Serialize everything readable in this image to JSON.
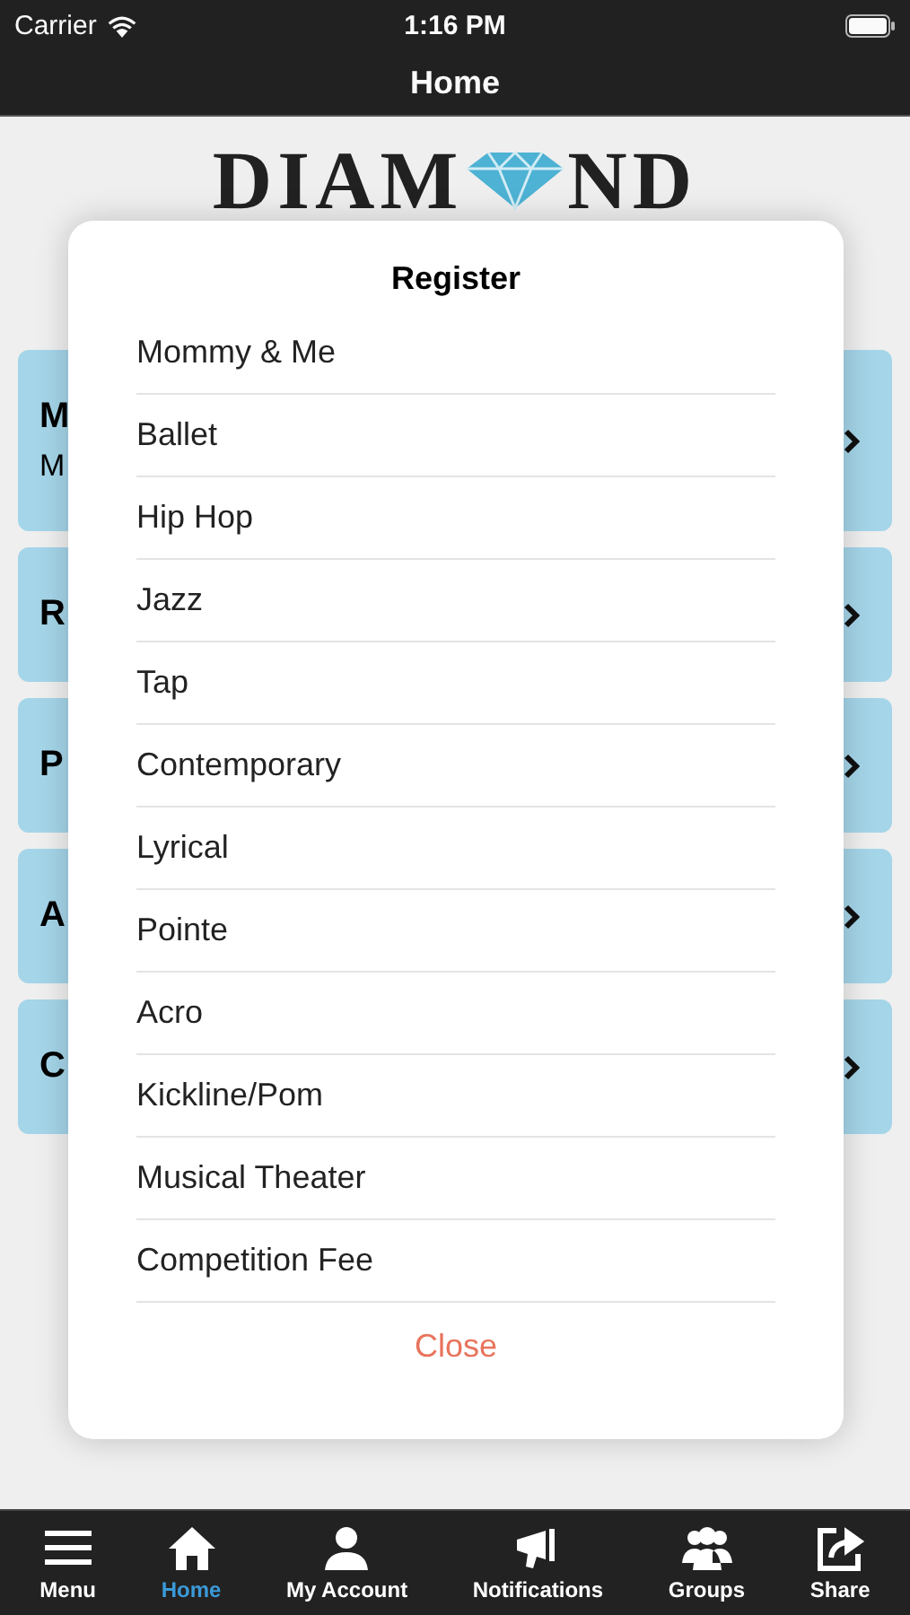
{
  "status_bar": {
    "carrier": "Carrier",
    "time": "1:16 PM"
  },
  "nav_bar": {
    "title": "Home"
  },
  "logo": {
    "left": "DIAM",
    "right": "ND"
  },
  "cards": [
    {
      "title": "M",
      "subtitle": "M"
    },
    {
      "title": "R"
    },
    {
      "title": "P"
    },
    {
      "title": "A"
    },
    {
      "title": "C"
    }
  ],
  "dialog": {
    "title": "Register",
    "items": [
      "Mommy & Me",
      "Ballet",
      "Hip Hop",
      "Jazz",
      "Tap",
      "Contemporary",
      "Lyrical",
      "Pointe",
      "Acro",
      "Kickline/Pom",
      "Musical Theater",
      "Competition Fee"
    ],
    "close": "Close"
  },
  "tab_bar": [
    {
      "label": "Menu",
      "kind": "menu",
      "selected": false
    },
    {
      "label": "Home",
      "kind": "home",
      "selected": true
    },
    {
      "label": "My Account",
      "kind": "person",
      "selected": false
    },
    {
      "label": "Notifications",
      "kind": "megaphone",
      "selected": false
    },
    {
      "label": "Groups",
      "kind": "group",
      "selected": false
    },
    {
      "label": "Share",
      "kind": "share",
      "selected": false
    }
  ]
}
